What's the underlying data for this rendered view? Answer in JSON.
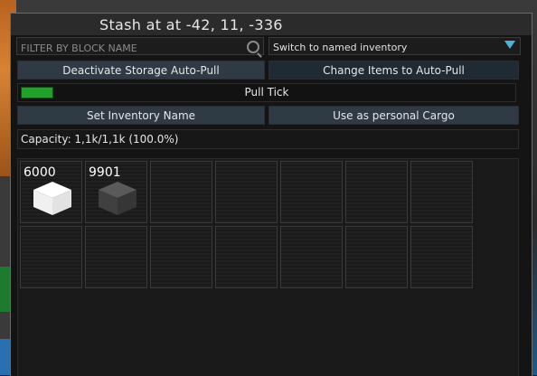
{
  "window": {
    "title": "Stash at at -42, 11, -336"
  },
  "filter": {
    "placeholder": "FILTER BY BLOCK NAME",
    "icon": "search-icon"
  },
  "dropdown": {
    "selected": "Switch to named inventory",
    "arrow_color": "#4ab3d6"
  },
  "buttons": {
    "deactivate_autopull": "Deactivate Storage Auto-Pull",
    "change_autopull": "Change Items to Auto-Pull",
    "set_inventory_name": "Set Inventory Name",
    "use_personal_cargo": "Use as personal Cargo"
  },
  "pull_tick": {
    "label": "Pull Tick",
    "toggle_on": true,
    "toggle_color": "#21a12b"
  },
  "capacity": {
    "text": "Capacity: 1,1k/1,1k (100.0%)"
  },
  "inventory": {
    "slots": [
      {
        "count": "6000",
        "item": "white-block",
        "color": "#f2f2f2"
      },
      {
        "count": "9901",
        "item": "grey-block",
        "color": "#4a4a4a"
      },
      {
        "count": "",
        "item": ""
      },
      {
        "count": "",
        "item": ""
      },
      {
        "count": "",
        "item": ""
      },
      {
        "count": "",
        "item": ""
      },
      {
        "count": "",
        "item": ""
      },
      {
        "count": "",
        "item": ""
      },
      {
        "count": "",
        "item": ""
      },
      {
        "count": "",
        "item": ""
      },
      {
        "count": "",
        "item": ""
      },
      {
        "count": "",
        "item": ""
      },
      {
        "count": "",
        "item": ""
      },
      {
        "count": "",
        "item": ""
      }
    ]
  }
}
